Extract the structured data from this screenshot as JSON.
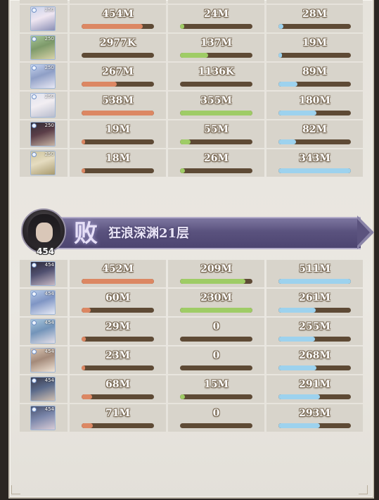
{
  "teams": [
    {
      "members": [
        {
          "level": "250",
          "values": [
            "454M",
            "24M",
            "28M"
          ],
          "bars": [
            0.84,
            0.06,
            0.07
          ]
        },
        {
          "level": "250",
          "values": [
            "2977K",
            "137M",
            "19M"
          ],
          "bars": [
            0.0,
            0.39,
            0.05
          ]
        },
        {
          "level": "250",
          "values": [
            "267M",
            "1136K",
            "89M"
          ],
          "bars": [
            0.49,
            0.0,
            0.26
          ]
        },
        {
          "level": "250",
          "values": [
            "538M",
            "355M",
            "180M"
          ],
          "bars": [
            1.0,
            1.0,
            0.52
          ]
        },
        {
          "level": "250",
          "values": [
            "19M",
            "55M",
            "82M"
          ],
          "bars": [
            0.04,
            0.15,
            0.24
          ]
        },
        {
          "level": "250",
          "values": [
            "18M",
            "26M",
            "343M"
          ],
          "bars": [
            0.03,
            0.07,
            1.0
          ]
        }
      ]
    },
    {
      "result": "败",
      "stage": "狂浪深渊21层",
      "leader_level": "454",
      "members": [
        {
          "level": "454",
          "values": [
            "452M",
            "209M",
            "511M"
          ],
          "bars": [
            1.0,
            0.9,
            1.0
          ]
        },
        {
          "level": "454",
          "values": [
            "60M",
            "230M",
            "261M"
          ],
          "bars": [
            0.13,
            1.0,
            0.51
          ]
        },
        {
          "level": "454",
          "values": [
            "29M",
            "0",
            "255M"
          ],
          "bars": [
            0.06,
            0.0,
            0.5
          ]
        },
        {
          "level": "454",
          "values": [
            "23M",
            "0",
            "268M"
          ],
          "bars": [
            0.05,
            0.0,
            0.52
          ]
        },
        {
          "level": "454",
          "values": [
            "68M",
            "15M",
            "291M"
          ],
          "bars": [
            0.15,
            0.07,
            0.57
          ]
        },
        {
          "level": "454",
          "values": [
            "71M",
            "0",
            "293M"
          ],
          "bars": [
            0.16,
            0.0,
            0.57
          ]
        }
      ]
    }
  ],
  "colors": {
    "damage": "#dc8763",
    "heal": "#9fcc66",
    "taken": "#9dd2ee",
    "track": "#5e4a35",
    "banner": "#5a527e"
  },
  "icons": {
    "portrait": "hero-portrait",
    "element": "element-badge"
  }
}
